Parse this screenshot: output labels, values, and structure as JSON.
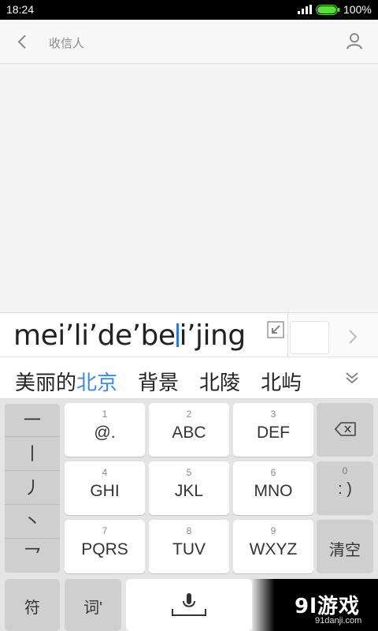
{
  "status_bar": {
    "time": "18:24",
    "battery_pct": "100%",
    "battery_level": 1.0
  },
  "header": {
    "recipient_placeholder": "收信人"
  },
  "composition": {
    "pinyin_before": "mei’li’de’be",
    "pinyin_after": "i’jing"
  },
  "candidates": {
    "first_plain": "美丽的",
    "first_highlight": "北京",
    "items": [
      "背景",
      "北陵",
      "北屿"
    ]
  },
  "keyboard": {
    "symbols": [
      "一",
      "丨",
      "丿",
      "丶",
      "乛"
    ],
    "keys": [
      {
        "num": "1",
        "label": "@."
      },
      {
        "num": "2",
        "label": "ABC"
      },
      {
        "num": "3",
        "label": "DEF"
      },
      {
        "num": "4",
        "label": "GHI"
      },
      {
        "num": "5",
        "label": "JKL"
      },
      {
        "num": "6",
        "label": "MNO"
      },
      {
        "num": "7",
        "label": "PQRS"
      },
      {
        "num": "8",
        "label": "TUV"
      },
      {
        "num": "9",
        "label": "WXYZ"
      }
    ],
    "zero_num": "0",
    "zero_label": ": )",
    "clear_label": "清空",
    "symbol_key_label": "符",
    "word_key_label": "词'"
  },
  "watermark": {
    "main": "9l游戏",
    "sub": "91danji.com"
  },
  "colors": {
    "accent": "#3f8ae6",
    "cursor": "#2e7bd6",
    "battery": "#5bdc3c"
  }
}
